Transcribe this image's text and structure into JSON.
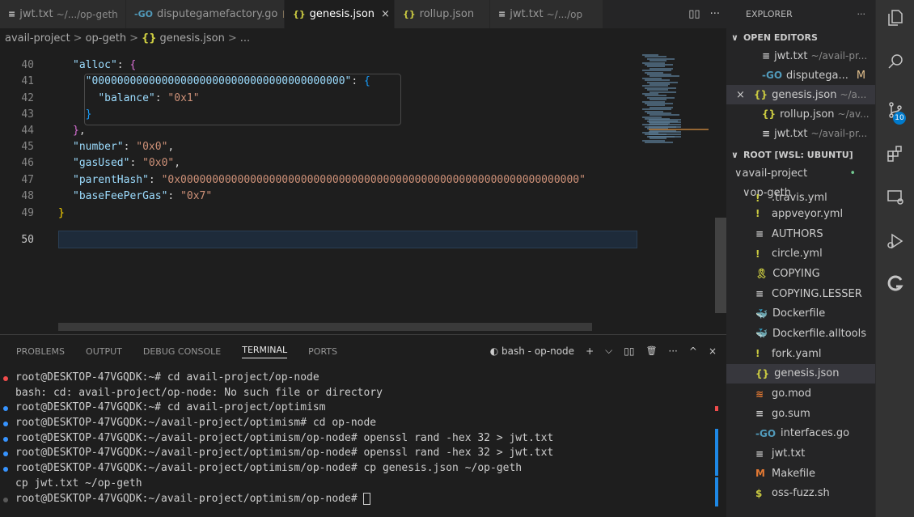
{
  "tabs": [
    {
      "icon": "≡",
      "label": "jwt.txt",
      "sub": "~/.../op-geth"
    },
    {
      "icon": "-GO",
      "label": "disputegamefactory.go",
      "mod": "M"
    },
    {
      "icon": "{}",
      "label": "genesis.json",
      "close": "×",
      "active": true
    },
    {
      "icon": "{}",
      "label": "rollup.json"
    },
    {
      "icon": "≡",
      "label": "jwt.txt",
      "sub": "~/.../op"
    }
  ],
  "tab_actions": [
    "▯▯",
    "···"
  ],
  "breadcrumb": {
    "items": [
      "avail-project",
      "op-geth",
      "genesis.json",
      "..."
    ],
    "sep": ">",
    "file_icon": "{}"
  },
  "editor": {
    "lines": [
      {
        "n": "40",
        "indent": "",
        "parts": [
          [
            "k",
            "\"alloc\""
          ],
          [
            "p",
            ": "
          ],
          [
            "b2",
            "{"
          ]
        ]
      },
      {
        "n": "41",
        "indent": "  ",
        "parts": [
          [
            "k",
            "\"0000000000000000000000000000000000000000\""
          ],
          [
            "p",
            ": "
          ],
          [
            "b3",
            "{"
          ]
        ]
      },
      {
        "n": "42",
        "indent": "    ",
        "parts": [
          [
            "k",
            "\"balance\""
          ],
          [
            "p",
            ": "
          ],
          [
            "s",
            "\"0x1\""
          ]
        ]
      },
      {
        "n": "43",
        "indent": "  ",
        "parts": [
          [
            "b3",
            "}"
          ]
        ]
      },
      {
        "n": "44",
        "indent": "",
        "parts": [
          [
            "b2",
            "}"
          ],
          [
            "p",
            ","
          ]
        ]
      },
      {
        "n": "45",
        "indent": "",
        "parts": [
          [
            "k",
            "\"number\""
          ],
          [
            "p",
            ": "
          ],
          [
            "s",
            "\"0x0\""
          ],
          [
            "p",
            ","
          ]
        ]
      },
      {
        "n": "46",
        "indent": "",
        "parts": [
          [
            "k",
            "\"gasUsed\""
          ],
          [
            "p",
            ": "
          ],
          [
            "s",
            "\"0x0\""
          ],
          [
            "p",
            ","
          ]
        ]
      },
      {
        "n": "47",
        "indent": "",
        "parts": [
          [
            "k",
            "\"parentHash\""
          ],
          [
            "p",
            ": "
          ],
          [
            "s",
            "\"0x000000000000000000000000000000000000000000000000000000000000000\""
          ]
        ]
      },
      {
        "n": "48",
        "indent": "",
        "parts": [
          [
            "k",
            "\"baseFeePerGas\""
          ],
          [
            "p",
            ": "
          ],
          [
            "s",
            "\"0x7\""
          ]
        ]
      },
      {
        "n": "49",
        "indent": "",
        "parts": [
          [
            "b1",
            "}"
          ]
        ],
        "outdent": true
      },
      {
        "n": "50",
        "indent": "",
        "parts": [],
        "current": true
      }
    ]
  },
  "panel": {
    "tabs": [
      "PROBLEMS",
      "OUTPUT",
      "DEBUG CONSOLE",
      "TERMINAL",
      "PORTS"
    ],
    "active_tab": "TERMINAL",
    "terminal_name": "bash - op-node",
    "actions": [
      "+",
      "⌵",
      "▯▯",
      "🗑",
      "···",
      "^",
      "×"
    ],
    "terminal_lines": [
      {
        "text": "root@DESKTOP-47VGQDK:~# cd avail-project/op-node",
        "dot": "#f14c4c"
      },
      {
        "text": "bash: cd: avail-project/op-node: No such file or directory",
        "dot": ""
      },
      {
        "text": "root@DESKTOP-47VGQDK:~# cd avail-project/optimism",
        "dot": "#3794ff"
      },
      {
        "text": "root@DESKTOP-47VGQDK:~/avail-project/optimism# cd op-node",
        "dot": "#3794ff"
      },
      {
        "text": "root@DESKTOP-47VGQDK:~/avail-project/optimism/op-node# openssl rand -hex 32 > jwt.txt",
        "dot": "#3794ff"
      },
      {
        "text": "root@DESKTOP-47VGQDK:~/avail-project/optimism/op-node# openssl rand -hex 32 > jwt.txt",
        "dot": "#3794ff"
      },
      {
        "text": "root@DESKTOP-47VGQDK:~/avail-project/optimism/op-node# cp genesis.json ~/op-geth",
        "dot": "#3794ff"
      },
      {
        "text": "cp jwt.txt ~/op-geth",
        "dot": ""
      },
      {
        "text": "root@DESKTOP-47VGQDK:~/avail-project/optimism/op-node# ",
        "dot": "#5a5a5a",
        "cursor": true
      }
    ]
  },
  "explorer": {
    "title": "EXPLORER",
    "title_more": "···",
    "open_editors_label": "OPEN EDITORS",
    "open_editors": [
      {
        "icon": "≡",
        "name": "jwt.txt",
        "path": "~/avail-pr..."
      },
      {
        "icon": "-GO",
        "name": "disputega...",
        "mod": "M"
      },
      {
        "icon": "{}",
        "name": "genesis.json",
        "path": "~/a...",
        "close": "×",
        "selected": true
      },
      {
        "icon": "{}",
        "name": "rollup.json",
        "path": "~/av..."
      },
      {
        "icon": "≡",
        "name": "jwt.txt",
        "path": "~/avail-pr..."
      }
    ],
    "root_label": "ROOT [WSL: UBUNTU]",
    "folders": [
      {
        "name": "avail-project",
        "marker": "•"
      },
      {
        "name": "op-geth"
      }
    ],
    "files": [
      {
        "icon": "!",
        "name": ".travis.yml",
        "color": "#cbcb41"
      },
      {
        "icon": "!",
        "name": "appveyor.yml",
        "color": "#cbcb41"
      },
      {
        "icon": "≡",
        "name": "AUTHORS",
        "color": "#cccccc"
      },
      {
        "icon": "!",
        "name": "circle.yml",
        "color": "#cbcb41"
      },
      {
        "icon": "🎗",
        "name": "COPYING",
        "color": "#cbcb41"
      },
      {
        "icon": "≡",
        "name": "COPYING.LESSER",
        "color": "#cccccc"
      },
      {
        "icon": "🐳",
        "name": "Dockerfile",
        "color": "#519aba"
      },
      {
        "icon": "🐳",
        "name": "Dockerfile.alltools",
        "color": "#519aba"
      },
      {
        "icon": "!",
        "name": "fork.yaml",
        "color": "#cbcb41"
      },
      {
        "icon": "{}",
        "name": "genesis.json",
        "color": "#cbcb41",
        "selected": true
      },
      {
        "icon": "≋",
        "name": "go.mod",
        "color": "#e37933"
      },
      {
        "icon": "≡",
        "name": "go.sum",
        "color": "#cccccc"
      },
      {
        "icon": "-GO",
        "name": "interfaces.go",
        "color": "#519aba"
      },
      {
        "icon": "≡",
        "name": "jwt.txt",
        "color": "#cccccc"
      },
      {
        "icon": "M",
        "name": "Makefile",
        "color": "#e37933"
      },
      {
        "icon": "$",
        "name": "oss-fuzz.sh",
        "color": "#cbcb41"
      }
    ]
  },
  "activity": {
    "source_control_badge": "10"
  },
  "colors": {
    "accent": "#007acc",
    "editor_bg": "#1e1e1e",
    "sidebar_bg": "#252526",
    "activity_bg": "#333333"
  }
}
